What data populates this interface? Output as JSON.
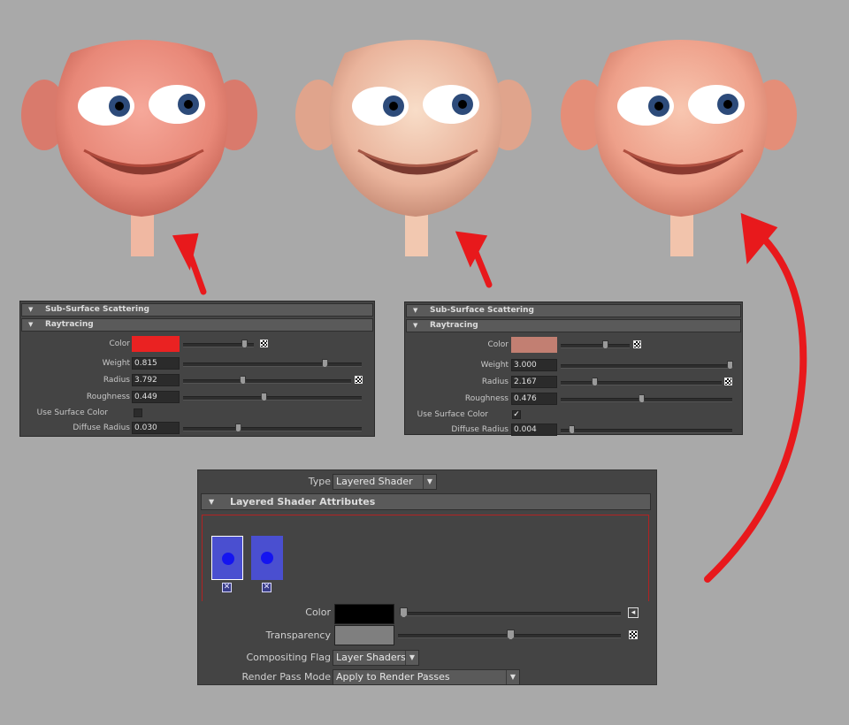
{
  "colors": {
    "background": "#a9a9a9",
    "panel": "#444444",
    "arrow": "#e8191c",
    "sss_color_1": "#ea2222",
    "sss_color_2": "#c27f72",
    "layered_color": "#000000",
    "layered_transparency": "#7f7f7f"
  },
  "panel1": {
    "section": "Sub-Surface Scattering",
    "subsection": "Raytracing",
    "color_label": "Color",
    "weight_label": "Weight",
    "weight": "0.815",
    "weight_frac": 0.8,
    "radius_label": "Radius",
    "radius": "3.792",
    "radius_frac": 0.35,
    "roughness_label": "Roughness",
    "roughness": "0.449",
    "roughness_frac": 0.45,
    "use_surface_label": "Use Surface Color",
    "use_surface": "",
    "diffuse_label": "Diffuse Radius",
    "diffuse": "0.030",
    "diffuse_frac": 0.3
  },
  "panel2": {
    "section": "Sub-Surface Scattering",
    "subsection": "Raytracing",
    "color_label": "Color",
    "weight_label": "Weight",
    "weight": "3.000",
    "weight_frac": 1.0,
    "radius_label": "Radius",
    "radius": "2.167",
    "radius_frac": 0.2,
    "roughness_label": "Roughness",
    "roughness": "0.476",
    "roughness_frac": 0.47,
    "use_surface_label": "Use Surface Color",
    "use_surface": "✓",
    "diffuse_label": "Diffuse Radius",
    "diffuse": "0.004",
    "diffuse_frac": 0.05
  },
  "layered": {
    "type_label": "Type",
    "type_value": "Layered Shader",
    "section": "Layered Shader Attributes",
    "color_label": "Color",
    "transparency_label": "Transparency",
    "transparency_frac": 0.5,
    "compositing_label": "Compositing Flag",
    "compositing_value": "Layer Shaders",
    "render_pass_label": "Render Pass Mode",
    "render_pass_value": "Apply to Render Passes",
    "layer_count": 2
  }
}
